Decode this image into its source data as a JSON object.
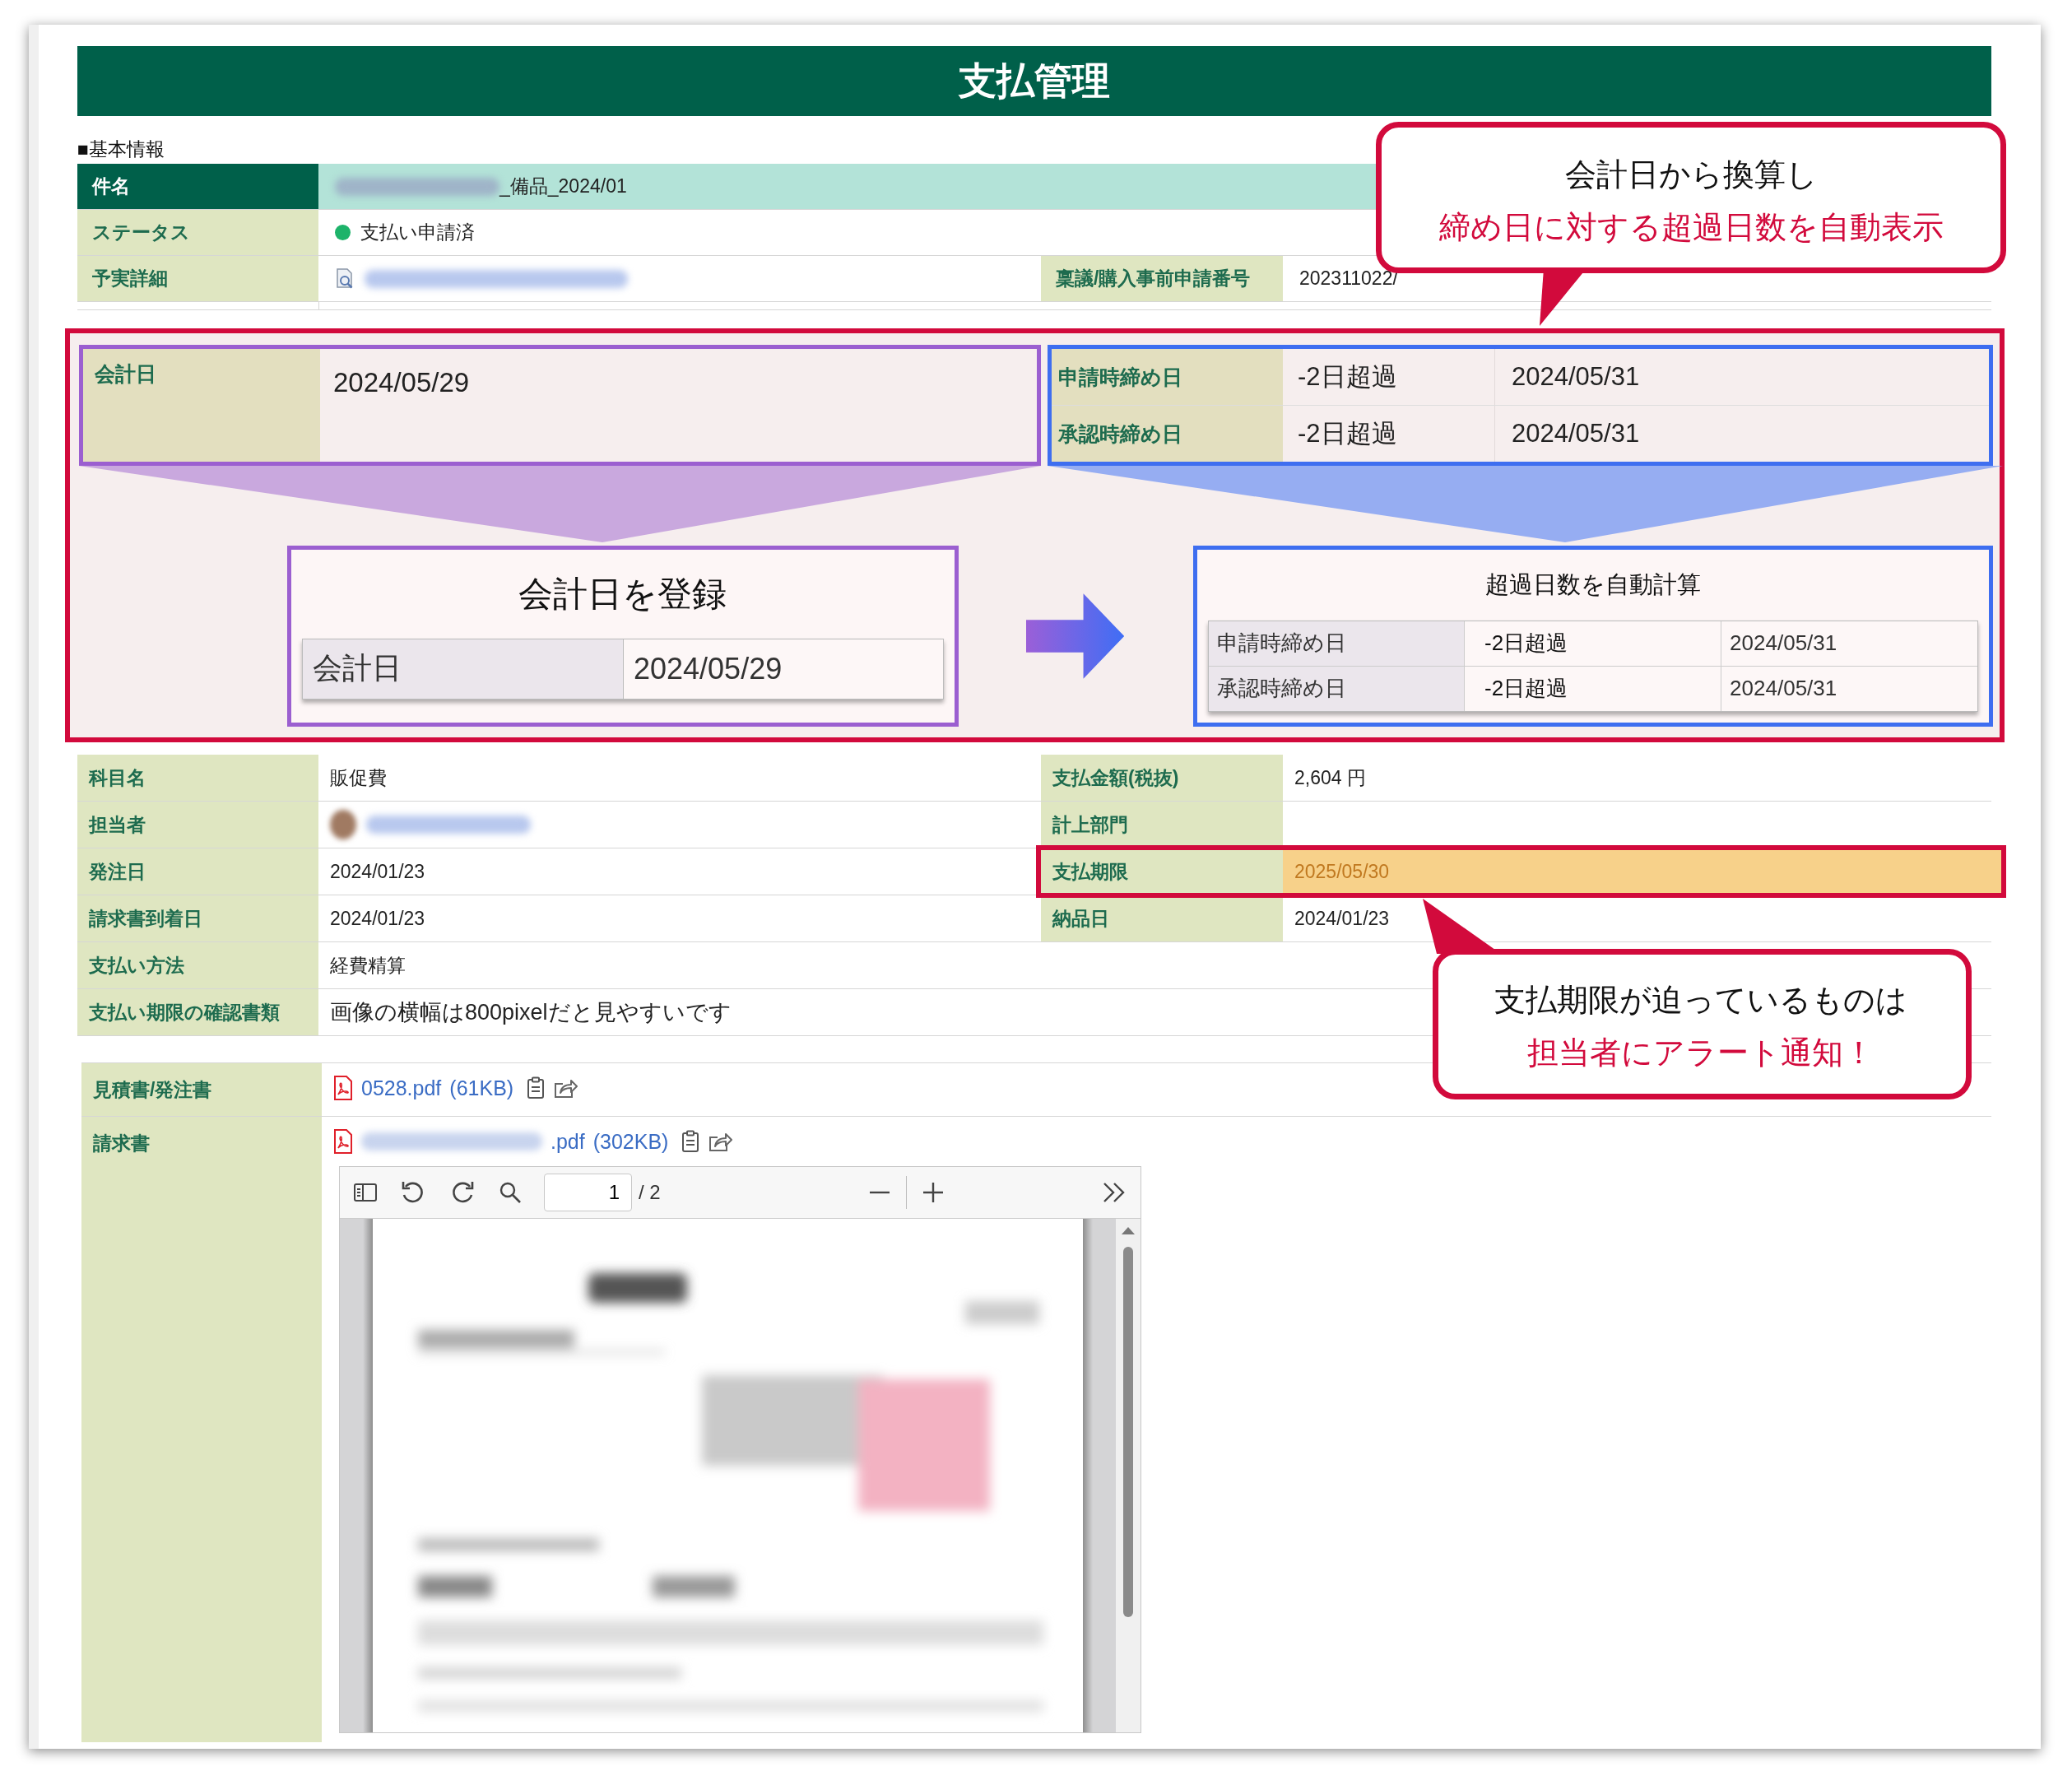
{
  "title": "支払管理",
  "section_label": "■基本情報",
  "header_rows": [
    {
      "kind": "subject",
      "label": "件名",
      "value": "_備品_2024/01"
    },
    {
      "kind": "status",
      "label": "ステータス",
      "value": "支払い申請済"
    },
    {
      "kind": "detail",
      "label": "予実詳細",
      "label_2": "稟議/購入事前申請番号",
      "value_2": "202311022/"
    }
  ],
  "accounting": {
    "date_label": "会計日",
    "date": "2024/05/29",
    "deadlines": [
      {
        "label": "申請時締め日",
        "overdue": "-2日超過",
        "date": "2024/05/31"
      },
      {
        "label": "承認時締め日",
        "overdue": "-2日超過",
        "date": "2024/05/31"
      }
    ],
    "register": {
      "title": "会計日を登録",
      "label": "会計日",
      "date": "2024/05/29"
    },
    "calculation": {
      "title": "超過日数を自動計算",
      "rows": [
        {
          "label": "申請時締め日",
          "overdue": "-2日超過",
          "date": "2024/05/31"
        },
        {
          "label": "承認時締め日",
          "overdue": "-2日超過",
          "date": "2024/05/31"
        }
      ]
    }
  },
  "detail_rows": [
    {
      "kind": "pair",
      "label": "科目名",
      "value": "販促費",
      "label_2": "支払金額(税抜)",
      "value_2": "2,604 円",
      "highlighted": false
    },
    {
      "kind": "person",
      "label": "担当者",
      "label_2": "計上部門",
      "highlighted": false
    },
    {
      "kind": "pair",
      "label": "発注日",
      "value": "2024/01/23",
      "label_2": "支払期限",
      "value_2": "2025/05/30",
      "highlighted": true
    },
    {
      "kind": "pair",
      "label": "請求書到着日",
      "value": "2024/01/23",
      "label_2": "納品日",
      "value_2": "2024/01/23",
      "highlighted": false
    },
    {
      "kind": "wide",
      "label": "支払い方法",
      "value": "経費精算",
      "highlighted": false
    },
    {
      "kind": "wide",
      "label": "支払い期限の確認書類",
      "value": "画像の横幅は800pixelだと見やすいです",
      "highlighted": false
    }
  ],
  "attachments": [
    {
      "label": "見積書/発注書",
      "file_name": "0528.pdf",
      "size": "(61KB)",
      "redacted": false
    },
    {
      "label": "請求書",
      "file_name": ".pdf",
      "size": "(302KB)",
      "redacted": true,
      "viewer": {
        "page": "1",
        "total": "/ 2"
      }
    }
  ],
  "callouts": [
    {
      "line_1": "会計日から換算し",
      "line_2": "締め日に対する超過日数を自動表示"
    },
    {
      "line_1": "支払期限が迫っているものは",
      "line_2": "担当者にアラート通知！"
    }
  ]
}
